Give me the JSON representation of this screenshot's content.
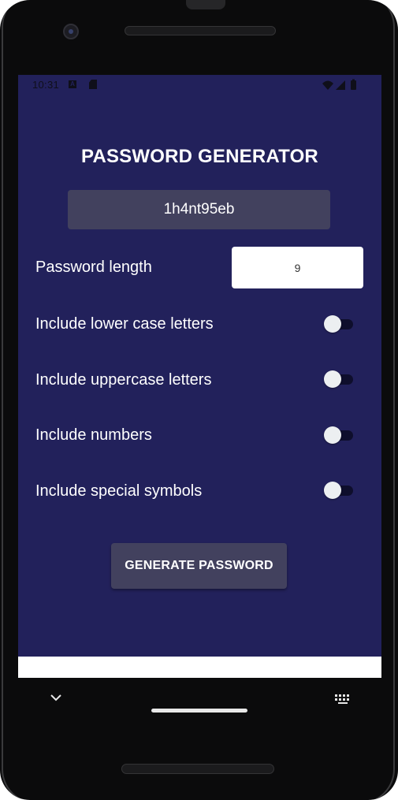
{
  "status_bar": {
    "time": "10:31",
    "icons": [
      "notification-a-icon",
      "sd-card-icon",
      "wifi-icon",
      "signal-icon",
      "battery-icon"
    ]
  },
  "app": {
    "title": "PASSWORD GENERATOR",
    "generated_password": "1h4nt95eb",
    "length_label": "Password length",
    "length_value": "9",
    "options": [
      {
        "label": "Include lower case letters",
        "enabled": false
      },
      {
        "label": "Include uppercase letters",
        "enabled": false
      },
      {
        "label": "Include numbers",
        "enabled": false
      },
      {
        "label": "Include special symbols",
        "enabled": false
      }
    ],
    "generate_button": "GENERATE PASSWORD"
  },
  "nav_bar": {
    "icons": [
      "chevron-down-icon",
      "home-handle",
      "keyboard-icon"
    ]
  },
  "colors": {
    "screen_bg": "#22215b",
    "surface": "#42415e",
    "text": "#ffffff"
  }
}
